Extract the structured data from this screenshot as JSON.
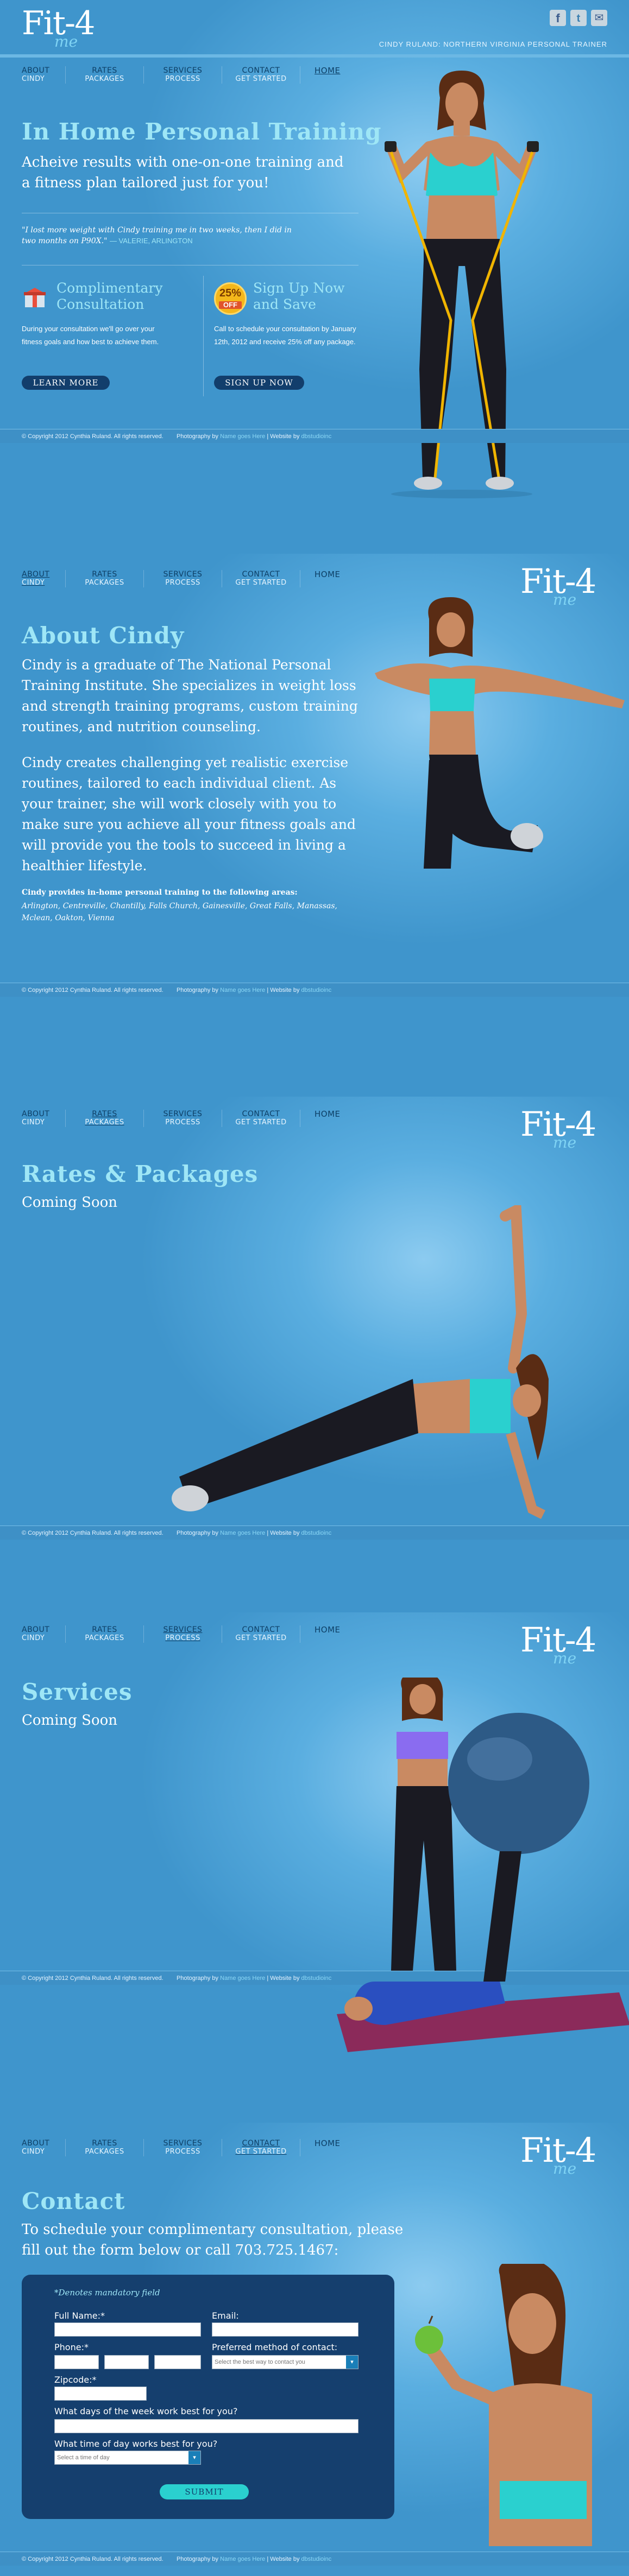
{
  "page": {
    "brand_main": "Fit-4",
    "brand_sub": "me",
    "tagline": "CINDY RULAND: NORTHERN VIRGINIA PERSONAL TRAINER"
  },
  "social": [
    "facebook",
    "twitter",
    "email"
  ],
  "nav": [
    {
      "top": "ABOUT",
      "sub": "CINDY"
    },
    {
      "top": "RATES",
      "sub": "PACKAGES"
    },
    {
      "top": "SERVICES",
      "sub": "PROCESS"
    },
    {
      "top": "CONTACT",
      "sub": "GET STARTED"
    },
    {
      "top": "HOME",
      "sub": ""
    }
  ],
  "home": {
    "title": "In Home Personal Training",
    "subtitle": "Acheive results with one-on-one training and a fitness plan tailored just for you!",
    "quote": "\"I lost more weight with Cindy training me in two weeks, then I did in two months on P90X.\"",
    "quote_author": "— VALERIE, ARLINGTON",
    "promo1_title": "Complimentary Consultation",
    "promo1_text": "During your consultation we'll go over your fitness goals and how best to achieve them.",
    "promo1_btn": "LEARN MORE",
    "promo2_badge_pct": "25%",
    "promo2_badge_off": "OFF",
    "promo2_title": "Sign Up Now and Save",
    "promo2_text": "Call to schedule your consultation by January 12th, 2012 and receive 25% off any package.",
    "promo2_btn": "SIGN UP NOW"
  },
  "about": {
    "title": "About Cindy",
    "p1": "Cindy is a graduate of The National Personal Training Institute. She specializes in weight loss and strength training programs, custom training routines, and nutrition counseling.",
    "p2": "Cindy creates challenging yet realistic exercise routines, tailored to each individual client.  As your trainer, she will work closely with you to make sure you achieve all your fitness goals and will provide you the tools to succeed in living a healthier lifestyle.",
    "areas_label": "Cindy provides in-home personal training to the following areas:",
    "areas": "Arlington, Centreville, Chantilly, Falls Church, Gainesville, Great Falls, Manassas, Mclean, Oakton, Vienna"
  },
  "rates": {
    "title": "Rates & Packages",
    "subtitle": "Coming Soon"
  },
  "services": {
    "title": "Services",
    "subtitle": "Coming Soon"
  },
  "contact": {
    "title": "Contact",
    "intro": "To schedule your complimentary consultation, please fill out the form below or call 703.725.1467:",
    "mandatory": "*Denotes mandatory field",
    "full_name": "Full Name:*",
    "email": "Email:",
    "phone": "Phone:*",
    "pref": "Preferred method of contact:",
    "pref_placeholder": "Select the best way to contact you",
    "zip": "Zipcode:*",
    "days": "What days of the week work best for you?",
    "time": "What time of day works best for you?",
    "time_placeholder": "Select a time of day",
    "submit": "SUBMIT"
  },
  "footer": {
    "copyright": "© Copyright 2012 Cynthia Ruland. All rights reserved.",
    "photo_label": "Photography by",
    "photo_credit": "Name goes Here",
    "sep": "|",
    "site_label": "Website by",
    "site_credit": "dbstudioinc"
  },
  "colors": {
    "accent": "#9ee6f6",
    "bg": "#4a9fd0",
    "dark": "#123e6c",
    "form_bg": "#153f6e"
  }
}
